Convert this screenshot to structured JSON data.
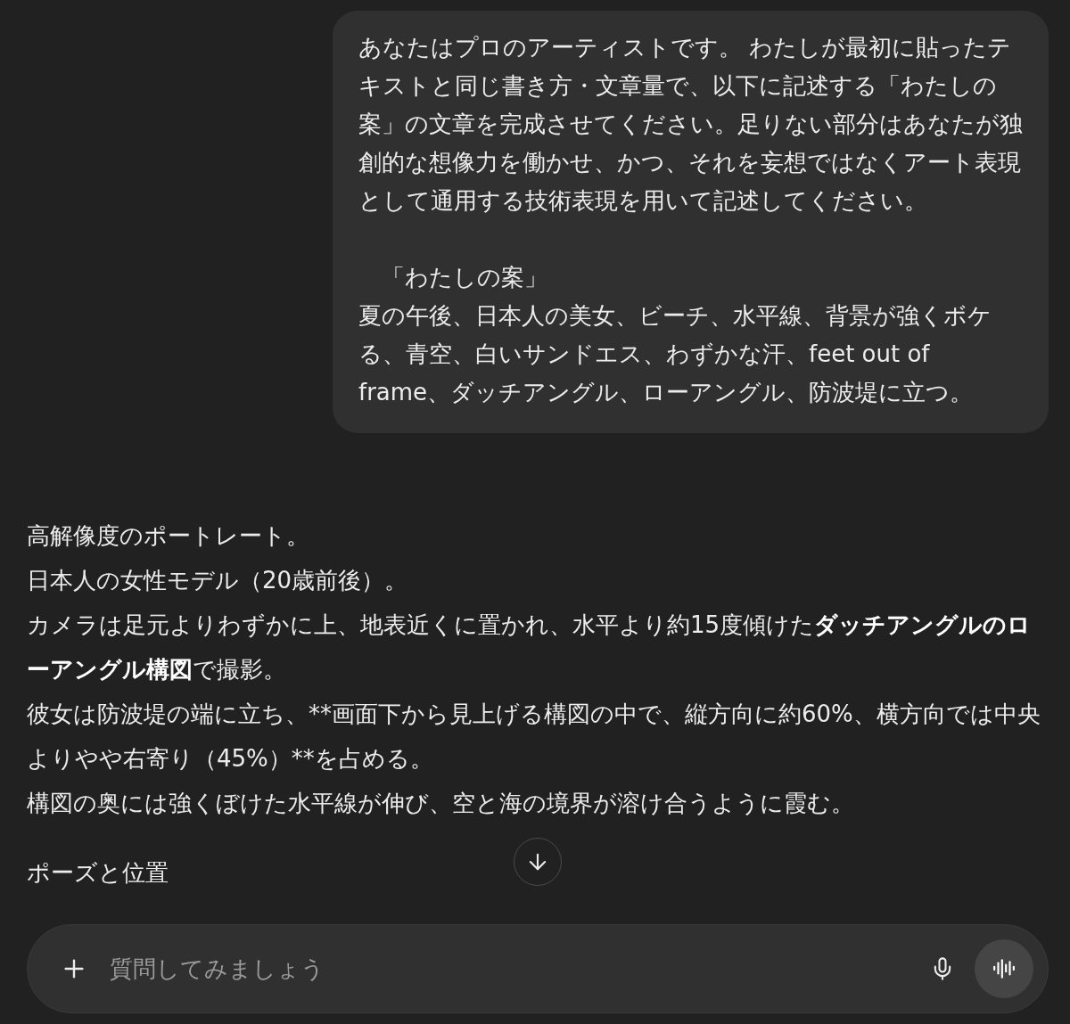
{
  "user_message": {
    "paragraphs": [
      {
        "lines": [
          "あなたはプロのアーティストです。 わたしが最初に貼ったテキストと同じ書き方・文章量で、以下に記述する「わたしの案」の文章を完成させてください。足りない部分はあなたが独創的な想像力を働かせ、かつ、それを妄想ではなくアート表現として通用する技術表現を用いて記述してください。"
        ]
      },
      {
        "lines": [
          "　「わたしの案」",
          "夏の午後、日本人の美女、ビーチ、水平線、背景が強くボケる、青空、白いサンドエス、わずかな汗、feet out of frame、ダッチアングル、ローアングル、防波堤に立つ。"
        ]
      }
    ]
  },
  "assistant_message": {
    "lines": [
      {
        "kind": "plain",
        "text": "高解像度のポートレート。"
      },
      {
        "kind": "plain",
        "text": "日本人の女性モデル（20歳前後）。"
      },
      {
        "kind": "rich",
        "text": "カメラは足元よりわずかに上、地表近くに置かれ、水平より約15度傾けた**ダッチアングルのローアングル構図**で撮影。"
      },
      {
        "kind": "plain",
        "text": "彼女は防波堤の端に立ち、**画面下から見上げる構図の中で、縦方向に約60%、横方向では中央よりやや右寄り（45%）**を占める。"
      },
      {
        "kind": "plain",
        "text": "構図の奥には強くぼけた水平線が伸び、空と海の境界が溶け合うように霞む。"
      },
      {
        "kind": "heading",
        "text": "ポーズと位置"
      }
    ]
  },
  "composer": {
    "placeholder": "質問してみましょう"
  }
}
